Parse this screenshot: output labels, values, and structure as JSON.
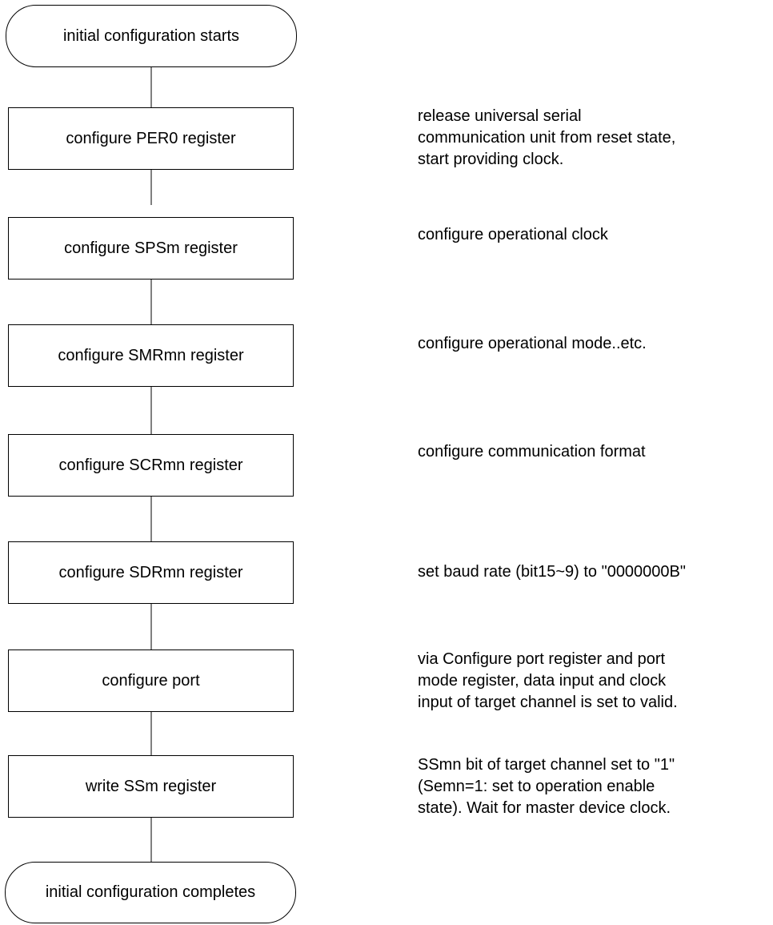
{
  "flowchart": {
    "start_label": "initial configuration starts",
    "end_label": "initial configuration completes",
    "steps": [
      {
        "label": "configure PER0 register",
        "note": "release universal serial\ncommunication unit from reset state,\nstart providing clock."
      },
      {
        "label": "configure SPSm register",
        "note": "configure operational clock"
      },
      {
        "label": "configure SMRmn register",
        "note": "configure operational mode..etc."
      },
      {
        "label": "configure SCRmn register",
        "note": "configure communication format"
      },
      {
        "label": "configure SDRmn register",
        "note": "set baud rate (bit15~9) to \"0000000B\""
      },
      {
        "label": "configure port",
        "note": "via Configure port register and port\nmode register, data input and clock\ninput of target channel is set to valid."
      },
      {
        "label": "write SSm register",
        "note": "SSmn bit of target channel set to \"1\"\n(Semn=1: set to operation enable\nstate). Wait for master device clock."
      }
    ]
  }
}
